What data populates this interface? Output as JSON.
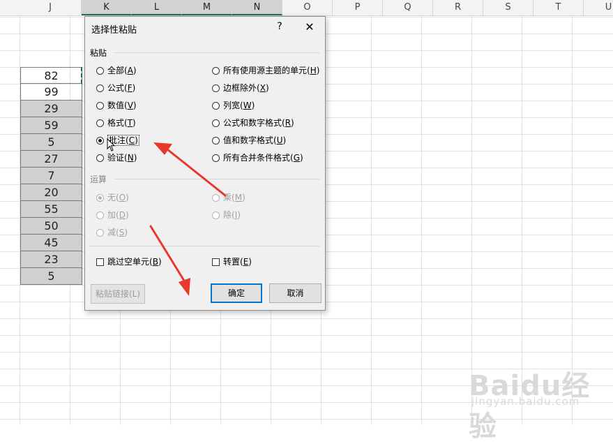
{
  "sheet": {
    "columns": [
      "J",
      "K",
      "L",
      "M",
      "N",
      "O",
      "P",
      "Q",
      "R",
      "S",
      "T",
      "U"
    ],
    "values": [
      "82",
      "99",
      "29",
      "59",
      "5",
      "27",
      "7",
      "20",
      "55",
      "50",
      "45",
      "23",
      "5"
    ]
  },
  "dialog": {
    "title": "选择性粘贴",
    "help": "?",
    "close": "✕",
    "paste_section": "粘贴",
    "paste_options_left": [
      {
        "label": "全部",
        "key": "A",
        "selected": false
      },
      {
        "label": "公式",
        "key": "F",
        "selected": false
      },
      {
        "label": "数值",
        "key": "V",
        "selected": false
      },
      {
        "label": "格式",
        "key": "T",
        "selected": false
      },
      {
        "label": "批注",
        "key": "C",
        "selected": true
      },
      {
        "label": "验证",
        "key": "N",
        "selected": false
      }
    ],
    "paste_options_right": [
      {
        "label": "所有使用源主题的单元",
        "key": "H"
      },
      {
        "label": "边框除外",
        "key": "X"
      },
      {
        "label": "列宽",
        "key": "W"
      },
      {
        "label": "公式和数字格式",
        "key": "R"
      },
      {
        "label": "值和数字格式",
        "key": "U"
      },
      {
        "label": "所有合并条件格式",
        "key": "G"
      }
    ],
    "operation_section": "运算",
    "operation_options_left": [
      {
        "label": "无",
        "key": "O",
        "selected": true
      },
      {
        "label": "加",
        "key": "D",
        "selected": false
      },
      {
        "label": "减",
        "key": "S",
        "selected": false
      }
    ],
    "operation_options_right": [
      {
        "label": "乘",
        "key": "M"
      },
      {
        "label": "除",
        "key": "I"
      }
    ],
    "skip_blanks": {
      "label": "跳过空单元",
      "key": "B"
    },
    "transpose": {
      "label": "转置",
      "key": "E"
    },
    "paste_link_button": "粘贴链接(L)",
    "ok_button": "确定",
    "cancel_button": "取消"
  },
  "watermark": {
    "brand": "Baidu经验",
    "url": "jingyan.baidu.com"
  },
  "colors": {
    "arrow": "#e8382c",
    "accent": "#0078d7",
    "selected_column": "#217346"
  }
}
